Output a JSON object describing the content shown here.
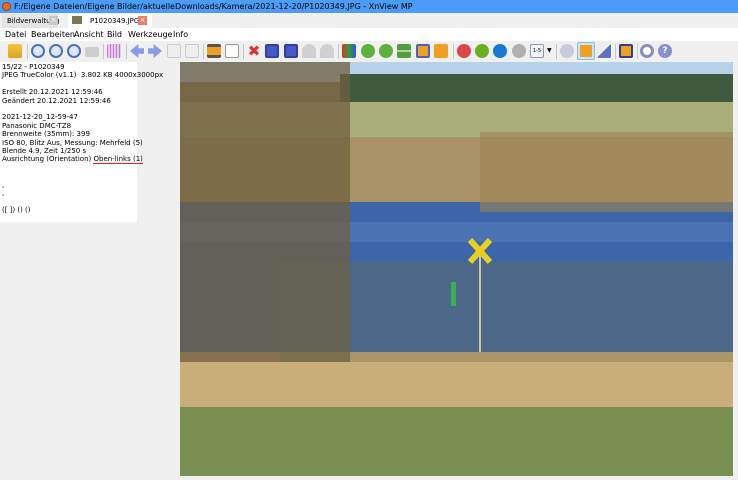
{
  "window": {
    "title": "F:/Eigene Dateien/Eigene Bilder/aktuelleDownloads/Kamera/2021-12-20/P1020349.JPG - XnView MP",
    "accent": "#4b9cf6"
  },
  "tabs": [
    {
      "label": "Bildverwaltung",
      "active": false
    },
    {
      "label": "P1020349.JPG",
      "active": true
    }
  ],
  "menu": [
    "Datei",
    "Bearbeiten",
    "Ansicht",
    "Bild",
    "Werkzeuge",
    "Info"
  ],
  "toolbar": [
    "folders-icon",
    "zoom-in-icon",
    "zoom-1to1-icon",
    "zoom-out-icon",
    "fit-icon",
    "grid-icon",
    "previous-icon",
    "next-icon",
    "first-icon",
    "last-icon",
    "slideshow-icon",
    "exif-date-icon",
    "delete-icon",
    "save-icon",
    "save-as-icon",
    "undo-icon",
    "redo-icon",
    "adjust-colors-icon",
    "rotate-left-icon",
    "rotate-right-icon",
    "flip-icon",
    "crop-icon",
    "resize-icon",
    "red-label-icon",
    "green-label-icon",
    "blue-label-icon",
    "gray-label-icon",
    "rating-icon",
    "comment-icon",
    "fullscreen-info-icon",
    "properties-icon",
    "fullscreen-icon",
    "settings-icon",
    "help-icon"
  ],
  "rating_label": "1-5",
  "info": {
    "line1": "15/22 - P1020349",
    "line2": "JPEG TrueColor (v1.1)  3.802 KB 4000x3000px",
    "created": "Erstellt 20.12.2021 12:59:46",
    "modified": "Geändert 20.12.2021 12:59:46",
    "exif_date": "2021-12-20_12-59-47",
    "camera": "Panasonic DMC-TZ8",
    "focal": "Brennweite (35mm): 399",
    "iso": "ISO 80, Blitz Aus, Messung: Mehrfeld (5)",
    "aperture": "Blende 4.9, Zeit 1/250 s",
    "orientation_label": "Ausrichtung (Orientation) ",
    "orientation_value": "Oben-links (1)",
    "extra1": ",",
    "extra2": ",",
    "extra3": "([ ]) () ()"
  }
}
